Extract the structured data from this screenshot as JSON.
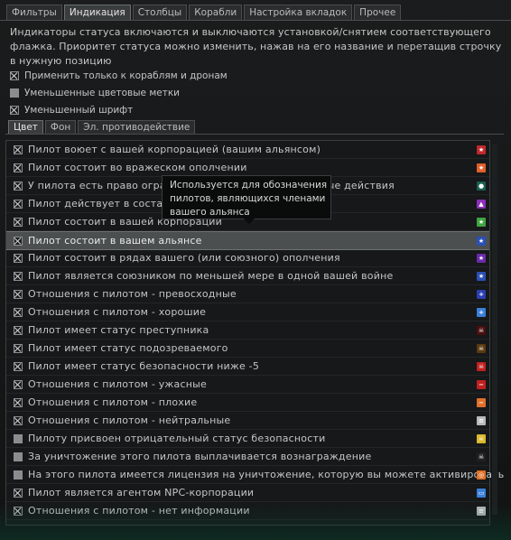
{
  "top_tabs": [
    {
      "label": "Фильтры",
      "active": false
    },
    {
      "label": "Индикация",
      "active": true
    },
    {
      "label": "Столбцы",
      "active": false
    },
    {
      "label": "Корабли",
      "active": false
    },
    {
      "label": "Настройка вкладок",
      "active": false
    },
    {
      "label": "Прочее",
      "active": false
    }
  ],
  "description": "Индикаторы статуса включаются и выключаются установкой/снятием соответствующего флажка. Приоритет статуса можно изменить, нажав на его название и перетащив строчку в нужную позицию",
  "options": [
    {
      "label": "Применить только к кораблям и дронам",
      "checked": true
    },
    {
      "label": "Уменьшенные цветовые метки",
      "checked": false
    },
    {
      "label": "Уменьшенный шрифт",
      "checked": true
    }
  ],
  "sub_tabs": [
    {
      "label": "Цвет",
      "active": true
    },
    {
      "label": "Фон",
      "active": false
    },
    {
      "label": "Эл. противодействие",
      "active": false
    }
  ],
  "rows": [
    {
      "label": "Пилот воюет с вашей корпорацией (вашим альянсом)",
      "checked": true,
      "icon": "star-icon",
      "color": "#c0282d"
    },
    {
      "label": "Пилот состоит во вражеском ополчении",
      "checked": true,
      "icon": "star-icon",
      "color": "#e0602a"
    },
    {
      "label": "У пилота есть право ограниченного вступления в боевые действия",
      "checked": true,
      "icon": "pod-icon",
      "color": "#1a5f4f"
    },
    {
      "label": "Пилот действует в составе вашего флота",
      "checked": true,
      "icon": "rocket-icon",
      "color": "#8a2fb8"
    },
    {
      "label": "Пилот состоит в вашей корпорации",
      "checked": true,
      "icon": "star-icon",
      "color": "#3fa43f"
    },
    {
      "label": "Пилот состоит в вашем альянсе",
      "checked": true,
      "icon": "star-icon",
      "color": "#2a4fb5",
      "selected": true
    },
    {
      "label": "Пилот состоит в рядах вашего (или союзного) ополчения",
      "checked": true,
      "icon": "star-icon",
      "color": "#6a2aa8"
    },
    {
      "label": "Пилот является союзником по меньшей мере в одной вашей войне",
      "checked": true,
      "icon": "star-icon",
      "color": "#2a4fb5"
    },
    {
      "label": " Отношения с пилотом - превосходные",
      "checked": true,
      "icon": "plus-icon",
      "color": "#2a3fb0"
    },
    {
      "label": " Отношения с пилотом - хорошие",
      "checked": true,
      "icon": "plus-icon",
      "color": "#3a7fd8"
    },
    {
      "label": "Пилот имеет статус преступника",
      "checked": true,
      "icon": "skull-icon",
      "color": "#4a0f0f"
    },
    {
      "label": "Пилот имеет статус подозреваемого",
      "checked": true,
      "icon": "skull-icon",
      "color": "#5a3a10"
    },
    {
      "label": "Пилот имеет статус безопасности ниже -5",
      "checked": true,
      "icon": "skull-icon",
      "color": "#c02020"
    },
    {
      "label": " Отношения с пилотом - ужасные",
      "checked": true,
      "icon": "minus-icon",
      "color": "#c02020"
    },
    {
      "label": " Отношения с пилотом - плохие",
      "checked": true,
      "icon": "minus-icon",
      "color": "#e0702a"
    },
    {
      "label": " Отношения с пилотом - нейтральные",
      "checked": true,
      "icon": "equals-icon",
      "color": "#b8baba"
    },
    {
      "label": "Пилоту присвоен отрицательный статус безопасности",
      "checked": false,
      "icon": "skull-icon",
      "color": "#d8b82a"
    },
    {
      "label": "За уничтожение этого пилота выплачивается вознаграждение",
      "checked": false,
      "icon": "skull-icon",
      "color": "#202020"
    },
    {
      "label": "На этого пилота имеется лицензия на уничтожение, которую вы можете активировать",
      "checked": false,
      "icon": "target-icon",
      "color": "#e0702a"
    },
    {
      "label": "Пилот является агентом NPC-корпорации",
      "checked": true,
      "icon": "chat-icon",
      "color": "#3a7fd8"
    },
    {
      "label": " Отношения с пилотом - нет информации",
      "checked": true,
      "icon": "equals-icon",
      "color": "#b8baba"
    }
  ],
  "tooltip": "Используется для обозначения пилотов, являющихся членами вашего альянса",
  "glyphs": {
    "star": "★",
    "plus": "+",
    "minus": "−",
    "equals": "≡",
    "skull": "☠",
    "rocket": "▲",
    "pod": "●",
    "target": "◎",
    "chat": "▭"
  }
}
